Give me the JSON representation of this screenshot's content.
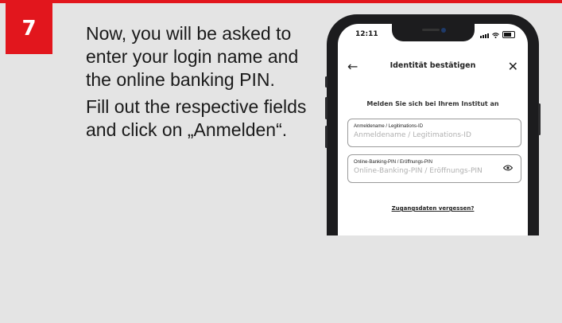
{
  "step": {
    "number": "7"
  },
  "instructions": {
    "paragraph_1": "Now, you will be asked to enter your login name and the online banking PIN.",
    "paragraph_2": "Fill out the respective fields and click on „Anmelden“."
  },
  "phone": {
    "status_time": "12:11",
    "nav": {
      "back_icon": "arrow-left-icon",
      "title": "Identität bestätigen",
      "close_icon": "close-icon"
    },
    "subtitle": "Melden Sie sich bei Ihrem Institut an",
    "login_field": {
      "label": "Anmeldename / Legitimations-ID",
      "placeholder": "Anmeldename / Legitimations-ID"
    },
    "pin_field": {
      "label": "Online-Banking-PIN / Eröffnungs-PIN",
      "placeholder": "Online-Banking-PIN / Eröffnungs-PIN",
      "toggle_icon": "eye-icon"
    },
    "forgot_link": "Zugangsdaten vergessen?"
  },
  "colors": {
    "accent": "#e2161d",
    "background": "#e4e4e4"
  }
}
